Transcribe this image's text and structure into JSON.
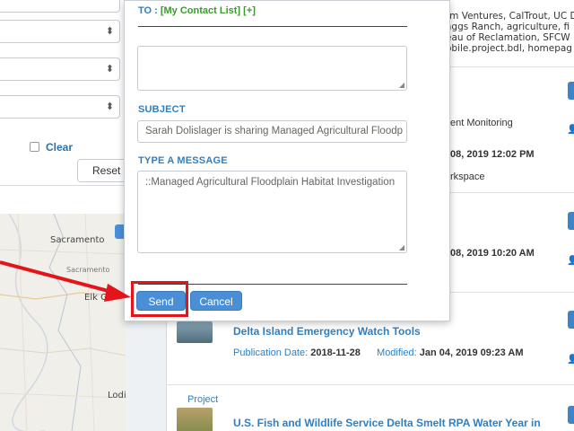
{
  "left_panel": {
    "clear_label": "Clear",
    "reset_label": "Reset"
  },
  "map": {
    "labels": {
      "sacramento": "Sacramento",
      "sacramento_small": "Sacramento",
      "elk": "Elk G",
      "lodi": "Lodi"
    }
  },
  "results": {
    "top_lines": [
      "rm Ventures, CalTrout, UC D",
      "aggs Ranch, agriculture, fi",
      "eau of Reclamation, SFCW",
      "obile.project.bdl, homepag"
    ],
    "r1": {
      "text": "ent Monitoring",
      "date": "08, 2019 12:02 PM",
      "workspace": "rkspace"
    },
    "r2": {
      "date": "08, 2019 10:20 AM"
    },
    "r3": {
      "title": "Delta Island Emergency Watch Tools",
      "pub_label": "Publication Date:",
      "pub_value": "2018-11-28",
      "mod_label": "Modified:",
      "mod_value": "Jan 04, 2019 09:23 AM"
    },
    "r4": {
      "type": "Project",
      "title": "U.S. Fish and Wildlife Service Delta Smelt RPA Water Year in"
    }
  },
  "modal": {
    "to_label": "TO :",
    "contact_list": "[My Contact List]",
    "add_label": "[+]",
    "subject_label": "SUBJECT",
    "subject_value": "Sarah Dolislager is sharing Managed Agricultural Floodp",
    "message_label": "TYPE A MESSAGE",
    "message_value": "::Managed Agricultural Floodplain Habitat Investigation",
    "send_label": "Send",
    "cancel_label": "Cancel"
  },
  "colors": {
    "accent": "#4a8fd6",
    "link": "#2f7fc1",
    "green": "#3a9a2c",
    "highlight": "#e3151a"
  }
}
